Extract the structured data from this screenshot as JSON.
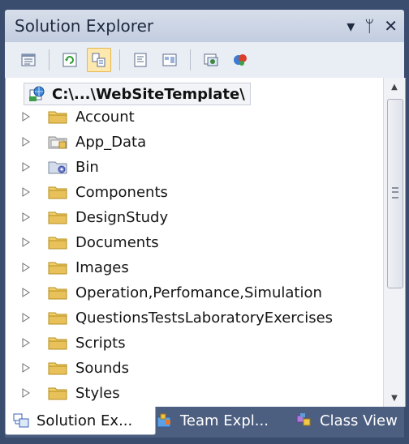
{
  "window": {
    "title": "Solution Explorer",
    "controls": {
      "dropdown": "▾",
      "pin": "ᛘ",
      "close": "✕"
    }
  },
  "toolbar": {
    "buttons": [
      {
        "icon": "properties-icon"
      },
      {
        "icon": "refresh-icon"
      },
      {
        "icon": "show-all-files-icon",
        "active": true
      },
      {
        "icon": "view-code-icon"
      },
      {
        "icon": "view-designer-icon"
      },
      {
        "icon": "copy-website-icon"
      },
      {
        "icon": "asp-net-config-icon"
      }
    ]
  },
  "tree": {
    "root_label": "C:\\...\\WebSiteTemplate\\",
    "items": [
      {
        "label": "Account",
        "icon": "folder-icon"
      },
      {
        "label": "App_Data",
        "icon": "app-data-folder-icon"
      },
      {
        "label": "Bin",
        "icon": "bin-folder-icon"
      },
      {
        "label": "Components",
        "icon": "folder-icon"
      },
      {
        "label": "DesignStudy",
        "icon": "folder-icon"
      },
      {
        "label": "Documents",
        "icon": "folder-icon"
      },
      {
        "label": "Images",
        "icon": "folder-icon"
      },
      {
        "label": "Operation,Perfomance,Simulation",
        "icon": "folder-icon"
      },
      {
        "label": "QuestionsTestsLaboratoryExercises",
        "icon": "folder-icon"
      },
      {
        "label": "Scripts",
        "icon": "folder-icon"
      },
      {
        "label": "Sounds",
        "icon": "folder-icon"
      },
      {
        "label": "Styles",
        "icon": "folder-icon"
      }
    ]
  },
  "tabs": [
    {
      "label": "Solution Ex...",
      "icon": "solution-explorer-icon",
      "active": true
    },
    {
      "label": "Team Expl...",
      "icon": "team-explorer-icon",
      "active": false
    },
    {
      "label": "Class View",
      "icon": "class-view-icon",
      "active": false
    }
  ],
  "colors": {
    "frame": "#3b4d6f",
    "titlebar": "#c9d3e4",
    "folder": "#e8c15a",
    "accent_active": "#e8b64c"
  }
}
